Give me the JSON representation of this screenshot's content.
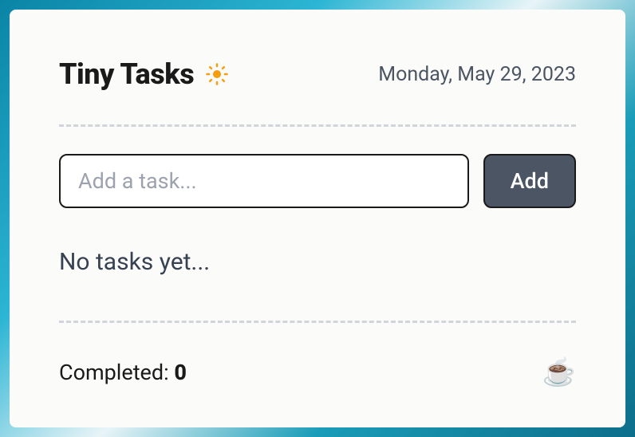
{
  "header": {
    "title": "Tiny Tasks",
    "date": "Monday, May 29, 2023"
  },
  "input": {
    "placeholder": "Add a task...",
    "value": ""
  },
  "buttons": {
    "add": "Add"
  },
  "empty_state": "No tasks yet...",
  "footer": {
    "completed_label": "Completed: ",
    "completed_count": "0"
  },
  "icons": {
    "sun_color": "#f59e0b",
    "coffee": "☕"
  }
}
